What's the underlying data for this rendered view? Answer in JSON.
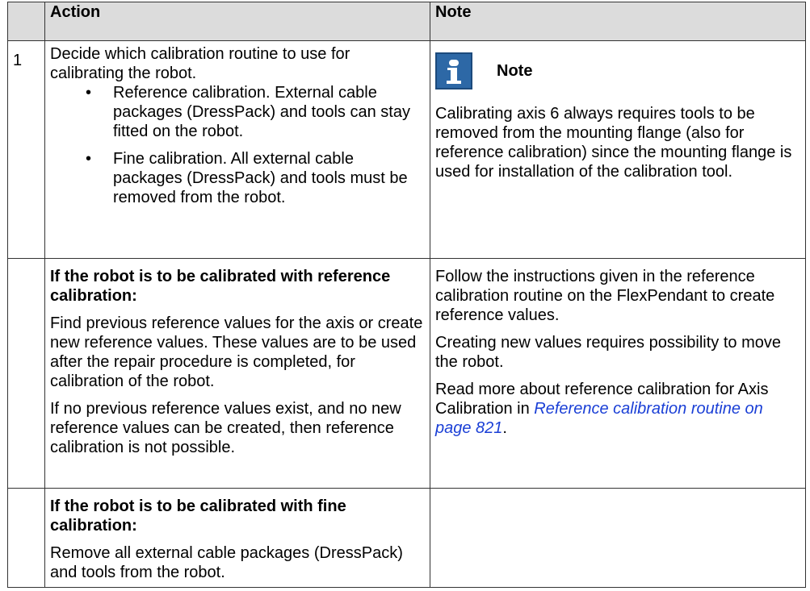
{
  "table": {
    "headers": {
      "number": "",
      "action": "Action",
      "note": "Note"
    },
    "row1": {
      "number": "1",
      "action_intro": "Decide which calibration routine to use for calibrating the robot.",
      "bullet": "•",
      "options": [
        "Reference calibration. External cable packages (DressPack) and tools can stay fitted on the robot.",
        "Fine calibration. All external cable packages (DressPack) and tools must be removed from the robot."
      ],
      "note_icon": "info-icon",
      "note_title": "Note",
      "note_text": "Calibrating axis 6 always requires tools to be removed from the mounting flange (also for reference calibration) since the mounting flange is used for installation of the calibration tool."
    },
    "row2": {
      "number": "",
      "action_heading": "If the robot is to be calibrated with reference calibration:",
      "action_p1": "Find previous reference values for the axis or create new reference values. These values are to be used after the repair procedure is completed, for calibration of the robot.",
      "action_p2": "If no previous reference values exist, and no new reference values can be created, then reference calibration is not possible.",
      "note_p1": "Follow the instructions given in the reference calibration routine on the FlexPendant to create reference values.",
      "note_p2": "Creating new values requires possibility to move the robot.",
      "note_p3_before": "Read more about reference calibration for Axis Calibration in ",
      "note_p3_link": "Reference calibration routine on page 821",
      "note_p3_after": "."
    },
    "row3": {
      "number": "",
      "action_heading": "If the robot is to be calibrated with fine calibration:",
      "action_p1": "Remove all external cable packages (DressPack) and tools from the robot.",
      "note": ""
    }
  },
  "colors": {
    "header_bg": "#dcdcdc",
    "icon_bg": "#2d68a6",
    "link": "#1a3fd6"
  }
}
